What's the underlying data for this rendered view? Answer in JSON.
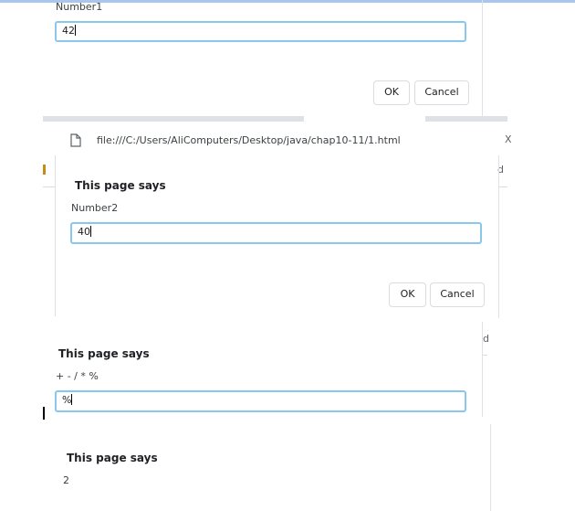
{
  "dialog1": {
    "label": "Number1",
    "input_value": "42",
    "ok_label": "OK",
    "cancel_label": "Cancel"
  },
  "browser": {
    "url": "file:///C:/Users/AliComputers/Desktop/java/chap10-11/1.html",
    "close_glyph": "X",
    "right_fragment": "d"
  },
  "dialog2": {
    "title": "This page says",
    "label": "Number2",
    "input_value": "40",
    "ok_label": "OK",
    "cancel_label": "Cancel"
  },
  "dialog3": {
    "title": "This page says",
    "label": "+ - / * %",
    "input_value": "%",
    "right_fragment": "d"
  },
  "dialog4": {
    "title": "This page says",
    "message": "2"
  },
  "icons": {
    "page": "page-icon",
    "close": "close-icon"
  }
}
